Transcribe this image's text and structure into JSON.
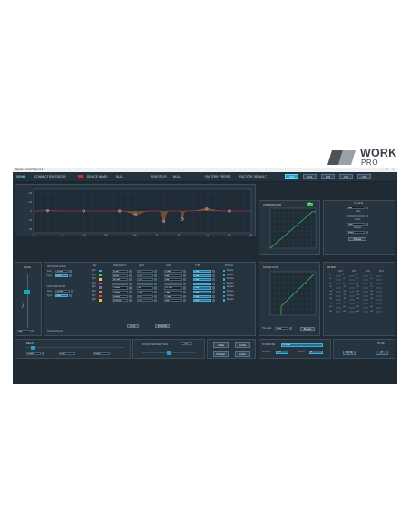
{
  "brand": {
    "work": "WORK",
    "pro": "PRO",
    "colors": {
      "mark_dark": "#4b5359",
      "mark_light": "#9aa1a6"
    }
  },
  "window": {
    "title": "Sigma1.0 Control Suite V1.0.0",
    "controls": "– □ ×"
  },
  "header": {
    "logo": "SIGMA",
    "connection_label": "CONNECTION STATUS:",
    "connection_color": "#e0242c",
    "device_label": "DEVICE NAME:",
    "device_value": "NULL",
    "remote_label": "REMOTE IP:",
    "remote_value": "NULL",
    "preset_label": "FACTORY PRESET:",
    "preset_value": "FACTORY DEFAULT",
    "channels": [
      {
        "label": "CH1",
        "active": true
      },
      {
        "label": "CH2",
        "active": false
      },
      {
        "label": "CH3",
        "active": false
      },
      {
        "label": "CH4",
        "active": false
      },
      {
        "label": "LINK",
        "active": false
      }
    ]
  },
  "eq_graph": {
    "y_ticks": [
      "+20",
      "+10",
      "0",
      "-10",
      "-20"
    ],
    "x_ticks": [
      "20",
      "50",
      "100",
      "200",
      "500",
      "1k",
      "2k",
      "5k",
      "10k",
      "20k"
    ],
    "curve_color": "#e02a4a"
  },
  "compressor": {
    "title": "COMPRESSOR",
    "badge": "ON",
    "threshold_label": "Threshold",
    "threshold_value": "-6dB",
    "ratio_label": "Ratio",
    "ratio_value": "1:20",
    "attack_label": "Attack",
    "attack_value": "15ms",
    "release_label": "Release",
    "release_value": "100ms",
    "bypass_label": "Bypass"
  },
  "gain": {
    "title": "GAIN",
    "value": "0dB"
  },
  "filters": {
    "hp_title": "HIGH PASS FILTER",
    "hp_freq_label": "Freq",
    "hp_freq_value": "20.0Hz",
    "hp_type_label": "Type",
    "hp_type_value": "BW6",
    "lp_title": "LOW PASS FILTER",
    "lp_freq_label": "Freq",
    "lp_freq_value": "20.0kHz",
    "lp_type_label": "Type",
    "lp_type_value": "BW6",
    "current_preset_label": "Current Preset:"
  },
  "eq_table": {
    "headers": [
      "EQ",
      "FREQUENCY",
      "Q/SLT",
      "GAIN",
      "TYPE",
      "BYPASS"
    ],
    "rows": [
      {
        "band": "EQ1",
        "color": "#3fa9f5",
        "freq": "31.3Hz",
        "q": "2.7",
        "gain": "0.3dB",
        "type": "Peak",
        "bypass": "Bypass"
      },
      {
        "band": "EQ2",
        "color": "#2ecc71",
        "freq": "98.0Hz",
        "q": "2.5",
        "gain": "0dB",
        "type": "Peak",
        "bypass": "Bypass"
      },
      {
        "band": "EQ3",
        "color": "#f5c542",
        "freq": "305.5Hz",
        "q": "1.0",
        "gain": "0dB",
        "type": "Peak",
        "bypass": "Bypass"
      },
      {
        "band": "EQ4",
        "color": "#e84393",
        "freq": "511.5Hz",
        "q": "4.0",
        "gain": "-4dB",
        "type": "Peak",
        "bypass": "Bypass"
      },
      {
        "band": "EQ5",
        "color": "#9b59b6",
        "freq": "1.25kHz",
        "q": "40",
        "gain": "-11.5dB",
        "type": "Peak",
        "bypass": "Bypass"
      },
      {
        "band": "EQ6",
        "color": "#e67e22",
        "freq": "2.25kHz",
        "q": "120",
        "gain": "-9dB",
        "type": "Peak",
        "bypass": "Bypass"
      },
      {
        "band": "EQ7",
        "color": "#e74c3c",
        "freq": "4.85kHz",
        "q": "2.5",
        "gain": "2.5dB",
        "type": "Peak",
        "bypass": "Bypass"
      },
      {
        "band": "EQ8",
        "color": "#f1c40f",
        "freq": "10.00kHz",
        "q": "2.5",
        "gain": "0dB",
        "type": "Peak",
        "bypass": "Bypass"
      }
    ],
    "flat_label": "FLAT",
    "bypass_label": "BYPASS"
  },
  "noise_gate": {
    "title": "NOISE GATE",
    "threshold_label": "Threshold",
    "threshold_value": "-90dB",
    "bypass_label": "Bypass"
  },
  "meter": {
    "title": "METER",
    "channels": [
      "CH1",
      "CH2",
      "CH3",
      "CH4"
    ],
    "scale": [
      "0",
      "-3",
      "-6",
      "-12",
      "-18",
      "-24",
      "-30",
      "-42",
      "-60",
      "-80"
    ]
  },
  "delay": {
    "title": "DELAY",
    "ms_value": "0.00ms",
    "feet_value": "0.00ft",
    "m_value": "0.00M",
    "level": 0.05
  },
  "room": {
    "label": "ROOM TEMPERATURE:",
    "value": "20°C"
  },
  "actions": {
    "save": "SAVE",
    "load": "LOAD",
    "preset": "PRESET",
    "lock": "LOCK"
  },
  "routing": {
    "workmode_label": "WORKMODE:",
    "workmode_value": "NORMAL",
    "output_label": "OUTPUT:",
    "output_value": "CH1",
    "input_label": "INPUT:",
    "input_value": "A"
  },
  "mute_phase": {
    "phase_label": "PHASE",
    "mute_button": "MUTE",
    "phase_button": "0°"
  }
}
